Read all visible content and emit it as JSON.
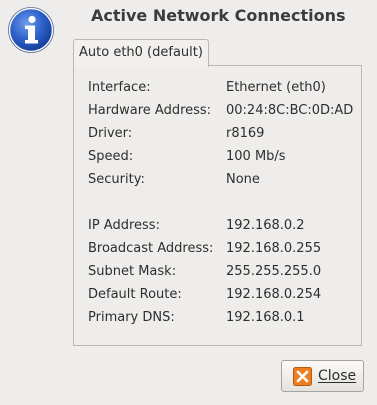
{
  "window": {
    "title": "Active Network Connections",
    "icon": "info-icon"
  },
  "tab": {
    "label": "Auto eth0 (default)"
  },
  "details": [
    {
      "label": "Interface:",
      "value": "Ethernet (eth0)"
    },
    {
      "label": "Hardware Address:",
      "value": "00:24:8C:BC:0D:AD"
    },
    {
      "label": "Driver:",
      "value": "r8169"
    },
    {
      "label": "Speed:",
      "value": "100 Mb/s"
    },
    {
      "label": "Security:",
      "value": "None"
    },
    {
      "label": "IP Address:",
      "value": "192.168.0.2"
    },
    {
      "label": "Broadcast Address:",
      "value": "192.168.0.255"
    },
    {
      "label": "Subnet Mask:",
      "value": "255.255.255.0"
    },
    {
      "label": "Default Route:",
      "value": "192.168.0.254"
    },
    {
      "label": "Primary DNS:",
      "value": "192.168.0.1"
    }
  ],
  "buttons": {
    "close_label": "Close",
    "close_icon": "close-x-icon"
  },
  "colors": {
    "info_blue": "#1d4fb8",
    "close_orange": "#e8731a"
  }
}
